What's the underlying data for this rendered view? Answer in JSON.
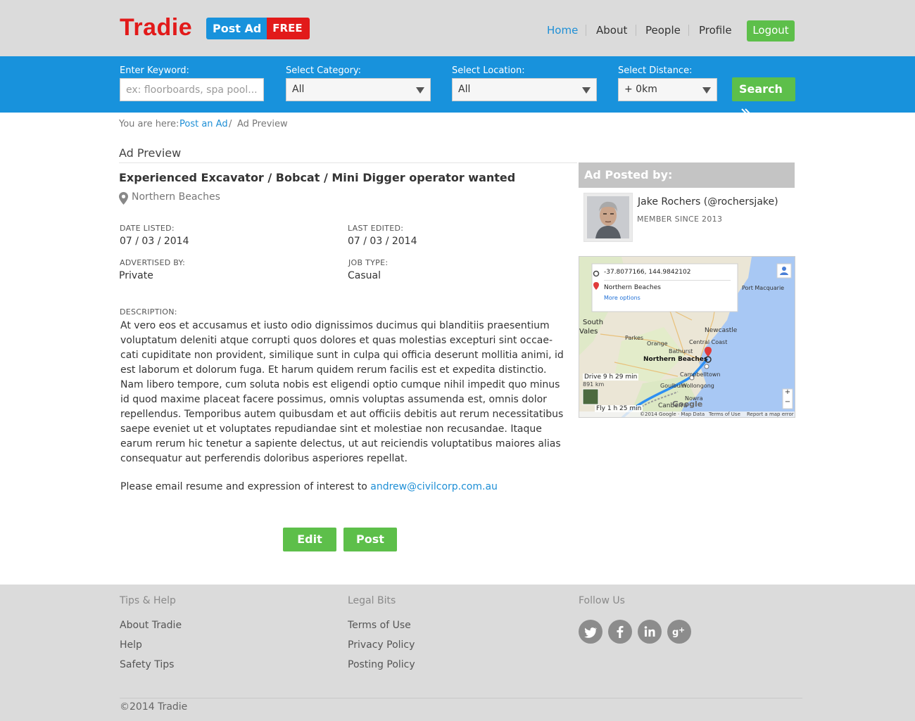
{
  "header": {
    "logo": "Tradie",
    "post_ad": "Post Ad",
    "free": "FREE",
    "nav": [
      "Home",
      "About",
      "People",
      "Profile"
    ],
    "logout": "Logout"
  },
  "search": {
    "keyword_label": "Enter Keyword:",
    "keyword_placeholder": "ex: floorboards, spa pool...",
    "category_label": "Select Category:",
    "category_value": "All",
    "location_label": "Select Location:",
    "location_value": "All",
    "distance_label": "Select Distance:",
    "distance_value": "+ 0km",
    "button": "Search"
  },
  "breadcrumb": {
    "prefix": "You are here:",
    "link": "Post an Ad",
    "sep": "/",
    "current": "Ad Preview"
  },
  "page_title": "Ad Preview",
  "ad": {
    "title": "Experienced Excavator / Bobcat / Mini Digger operator wanted",
    "location": "Northern Beaches",
    "date_listed_label": "DATE LISTED:",
    "date_listed": "07 / 03 / 2014",
    "last_edited_label": "LAST EDITED:",
    "last_edited": "07 / 03 / 2014",
    "advertised_by_label": "ADVERTISED BY:",
    "advertised_by": "Private",
    "job_type_label": "JOB TYPE:",
    "job_type": "Casual",
    "description_label": "DESCRIPTION:",
    "description": "At vero eos et accusamus et iusto odio dignissimos ducimus qui blanditiis praesentium voluptatum deleniti atque corrupti quos dolores et quas molestias excepturi sint occae-cati cupiditate non provident, similique sunt in culpa qui officia deserunt mollitia animi, id est laborum et dolorum fuga. Et harum quidem rerum facilis est et expedita distinctio. Nam libero tempore, cum soluta nobis est eligendi optio cumque nihil impedit quo minus id quod maxime placeat facere possimus, omnis voluptas assumenda est, omnis dolor repellendus. Temporibus autem quibusdam et aut officiis debitis aut rerum necessitatibus saepe eveniet ut et voluptates repudiandae sint et molestiae non recusandae. Itaque earum rerum hic tenetur a sapiente delectus, ut aut reiciendis voluptatibus maiores alias consequatur aut perferendis doloribus asperiores repellat.",
    "contact_text": "Please email resume and expression of interest to",
    "contact_email": "andrew@civilcorp.com.au"
  },
  "actions": {
    "edit": "Edit",
    "post": "Post"
  },
  "poster": {
    "header": "Ad Posted by:",
    "name": "Jake Rochers  (@rochersjake)",
    "since": "MEMBER SINCE 2013"
  },
  "map": {
    "coords": "-37.8077166, 144.9842102",
    "dest": "Northern Beaches",
    "more": "More options",
    "drive": "Drive 9 h 29 min",
    "drive_km": "891 km",
    "fly": "Fly 1 h 25 min",
    "labels": [
      "Newcastle",
      "Central Coast",
      "Parkes",
      "Orange",
      "Bathurst",
      "Northern Beaches",
      "Campbelltown",
      "Goulburn",
      "Wollongong",
      "Canberra",
      "Nowra",
      "Port Macquarie",
      "South",
      "Vales"
    ],
    "footer": "©2014 Google · Map Data",
    "terms": "Terms of Use",
    "report": "Report a map error",
    "google": "Google"
  },
  "footer": {
    "col1_title": "Tips & Help",
    "col1_links": [
      "About Tradie",
      "Help",
      "Safety Tips"
    ],
    "col2_title": "Legal Bits",
    "col2_links": [
      "Terms of Use",
      "Privacy Policy",
      "Posting Policy"
    ],
    "col3_title": "Follow Us",
    "social": [
      "twitter-icon",
      "facebook-icon",
      "linkedin-icon",
      "google-plus-icon"
    ],
    "copyright": "©2014 Tradie"
  },
  "colors": {
    "brand_red": "#e21a1a",
    "brand_blue": "#1892dc",
    "green": "#5dbf4a"
  }
}
